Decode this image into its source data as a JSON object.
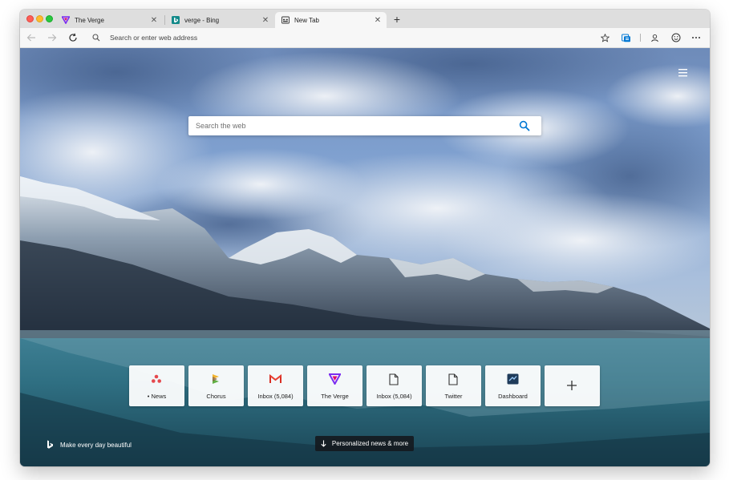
{
  "tabs": [
    {
      "title": "The Verge",
      "favicon": "verge-logo-icon",
      "active": false
    },
    {
      "title": "verge - Bing",
      "favicon": "bing-logo-icon",
      "active": false
    },
    {
      "title": "New Tab",
      "favicon": "new-tab-page-icon",
      "active": true
    }
  ],
  "toolbar": {
    "address_placeholder": "Search or enter web address"
  },
  "page": {
    "search_placeholder": "Search the web",
    "tiles": [
      {
        "label": "• News",
        "icon": "news-icon"
      },
      {
        "label": "Chorus",
        "icon": "chorus-icon"
      },
      {
        "label": "Inbox (5,084)",
        "icon": "gmail-icon"
      },
      {
        "label": "The Verge",
        "icon": "verge-logo-icon"
      },
      {
        "label": "Inbox (5,084)",
        "icon": "document-icon"
      },
      {
        "label": "Twitter",
        "icon": "document-icon"
      },
      {
        "label": "Dashboard",
        "icon": "dashboard-icon"
      }
    ],
    "add_tile_icon": "plus-icon",
    "brand_text": "Make every day beautiful",
    "news_button": "Personalized news & more"
  },
  "colors": {
    "accent": "#0078d4",
    "verge": "#5200ff",
    "gmail_red": "#d93025"
  }
}
